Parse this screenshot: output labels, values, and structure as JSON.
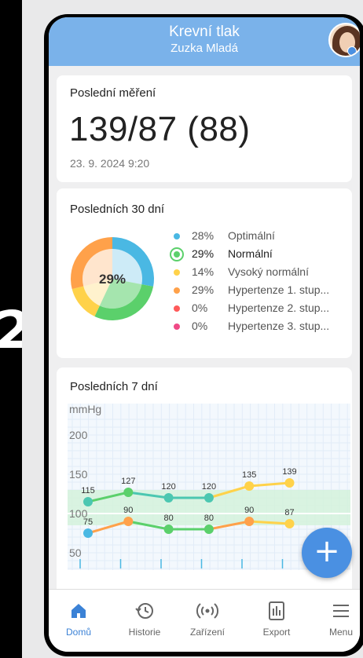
{
  "side_label": "2",
  "header": {
    "title": "Krevní tlak",
    "subtitle": "Zuzka Mladá"
  },
  "last_measurement": {
    "title": "Poslední měření",
    "value": "139/87 (88)",
    "date": "23. 9. 2024 9:20"
  },
  "last30": {
    "title": "Posledních 30 dní",
    "center_label": "29%",
    "items": [
      {
        "pct": "28%",
        "label": "Optimální",
        "color": "#4ab8e3",
        "value": 28
      },
      {
        "pct": "29%",
        "label": "Normální",
        "color": "#5bd06b",
        "value": 29
      },
      {
        "pct": "14%",
        "label": "Vysoký normální",
        "color": "#ffd24a",
        "value": 14
      },
      {
        "pct": "29%",
        "label": "Hypertenze 1. stup...",
        "color": "#ffa14a",
        "value": 29
      },
      {
        "pct": "0%",
        "label": "Hypertenze 2. stup...",
        "color": "#ff5a5a",
        "value": 0
      },
      {
        "pct": "0%",
        "label": "Hypertenze 3. stup...",
        "color": "#f04a86",
        "value": 0
      }
    ],
    "active_index": 1
  },
  "last7": {
    "title": "Posledních 7 dní"
  },
  "chart_data": {
    "type": "line",
    "ylabel": "mmHg",
    "yticks": [
      200,
      150,
      100,
      50
    ],
    "ylim": [
      20,
      220
    ],
    "bands": [
      {
        "from": 85,
        "to": 130,
        "color": "#d4f2dc"
      }
    ],
    "series": [
      {
        "values": [
          115,
          127,
          120,
          120,
          135,
          139
        ],
        "colors": [
          "#4bc7b1",
          "#5bd06b",
          "#4bc7b1",
          "#4bc7b1",
          "#ffd24a",
          "#ffd24a"
        ]
      },
      {
        "values": [
          75,
          90,
          80,
          80,
          90,
          87
        ],
        "colors": [
          "#4ab8e3",
          "#ffa14a",
          "#5bd06b",
          "#5bd06b",
          "#ffa14a",
          "#ffd24a"
        ]
      }
    ],
    "x_index": [
      0,
      1,
      2,
      3,
      4,
      5
    ],
    "x_count": 7
  },
  "fab": {
    "label": "+"
  },
  "nav": [
    {
      "label": "Domů",
      "icon": "home-icon",
      "active": true
    },
    {
      "label": "Historie",
      "icon": "history-icon",
      "active": false
    },
    {
      "label": "Zařízení",
      "icon": "device-icon",
      "active": false
    },
    {
      "label": "Export",
      "icon": "export-icon",
      "active": false
    },
    {
      "label": "Menu",
      "icon": "menu-icon",
      "active": false
    }
  ],
  "colors": {
    "header": "#7ab2ea",
    "accent": "#3b82d6",
    "fab": "#4a90e2"
  }
}
